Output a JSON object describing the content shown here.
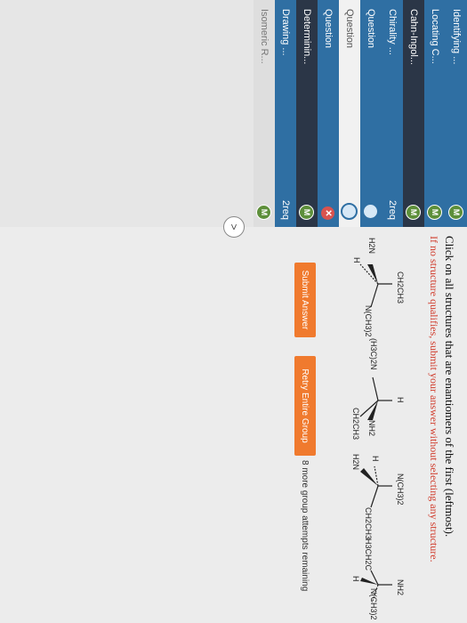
{
  "sidebar": {
    "items": [
      {
        "label": "Identifying ...",
        "badge": "M"
      },
      {
        "label": "Locating C...",
        "badge": "M"
      },
      {
        "label": "Cahn-Ingol...",
        "badge": "M"
      },
      {
        "label": "Chirality ...",
        "req": "2req"
      },
      {
        "label": "Question",
        "badge": ""
      },
      {
        "label": "Question",
        "badge": ""
      },
      {
        "label": "Determinin...",
        "badge": "M"
      },
      {
        "label": "Drawing ...",
        "req": "2req"
      },
      {
        "label": "Isomeric R...",
        "badge": "M"
      }
    ]
  },
  "question": {
    "instruction": "Click on all structures that are enantiomers of the first (leftmost).",
    "note": "If no structure qualifies, submit your answer without selecting any structure.",
    "molecules": [
      {
        "top": "CH2CH3",
        "left": "H2N",
        "right": "N(CH3)2",
        "bottom": "H"
      },
      {
        "top": "H",
        "left": "(H3C)2N",
        "right": "NH2",
        "bottom": "CH2CH3"
      },
      {
        "top": "N(CH3)2",
        "left": "H",
        "right": "CH2CH3",
        "bottom": "H2N"
      },
      {
        "top": "NH2",
        "left": "H3CH2C",
        "right": "N(CH3)2",
        "bottom": "H"
      }
    ]
  },
  "buttons": {
    "submit": "Submit Answer",
    "retry": "Retry Entire Group"
  },
  "remaining": "8 more group attempts remaining",
  "collapse": ">"
}
